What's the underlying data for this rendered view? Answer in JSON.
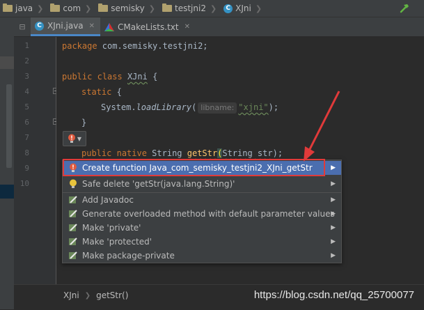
{
  "navbar": {
    "crumbs": [
      "java",
      "com",
      "semisky",
      "testjni2",
      "XJni"
    ],
    "tool_icon": "hammer-icon"
  },
  "tabs": [
    {
      "label": "XJni.java",
      "icon": "java-class-icon",
      "active": true
    },
    {
      "label": "CMakeLists.txt",
      "icon": "cmake-icon",
      "active": false
    }
  ],
  "line_numbers": [
    "1",
    "2",
    "3",
    "4",
    "5",
    "6",
    "7",
    "8",
    "9",
    "10"
  ],
  "code": {
    "l1_kw": "package",
    "l1_rest": " com.semisky.testjni2;",
    "l3_kw1": "public",
    "l3_kw2": "class",
    "l3_name": "XJni",
    "l3_brace": " {",
    "l4_kw": "static",
    "l4_brace": " {",
    "l5_a": "System.",
    "l5_method": "loadLibrary",
    "l5_paren": "(",
    "l5_hint": "libname:",
    "l5_str": "\"xjni\"",
    "l5_end": ");",
    "l6_brace": "}",
    "l8_kw1": "public",
    "l8_kw2": "native",
    "l8_type": " String ",
    "l8_name": "getStr",
    "l8_paren": "(",
    "l8_args": "String str",
    "l8_end": ");"
  },
  "popup": {
    "items": [
      {
        "label": "Create function Java_com_semisky_testjni2_XJni_getStr",
        "icon": "error-bulb-icon",
        "selected": true
      },
      {
        "label": "Safe delete 'getStr(java.lang.String)'",
        "icon": "bulb-icon",
        "selected": false
      },
      {
        "label": "Add Javadoc",
        "icon": "intention-icon",
        "selected": false
      },
      {
        "label": "Generate overloaded method with default parameter values",
        "icon": "intention-icon",
        "selected": false
      },
      {
        "label": "Make 'private'",
        "icon": "intention-icon",
        "selected": false
      },
      {
        "label": "Make 'protected'",
        "icon": "intention-icon",
        "selected": false
      },
      {
        "label": "Make package-private",
        "icon": "intention-icon",
        "selected": false
      }
    ]
  },
  "bottom": {
    "crumbs": [
      "XJni",
      "getStr()"
    ],
    "watermark": "https://blog.csdn.net/qq_25700077"
  },
  "colors": {
    "accent_selection": "#4b6eaf",
    "annotation_red": "#e03a3a",
    "keyword": "#cc7832"
  }
}
